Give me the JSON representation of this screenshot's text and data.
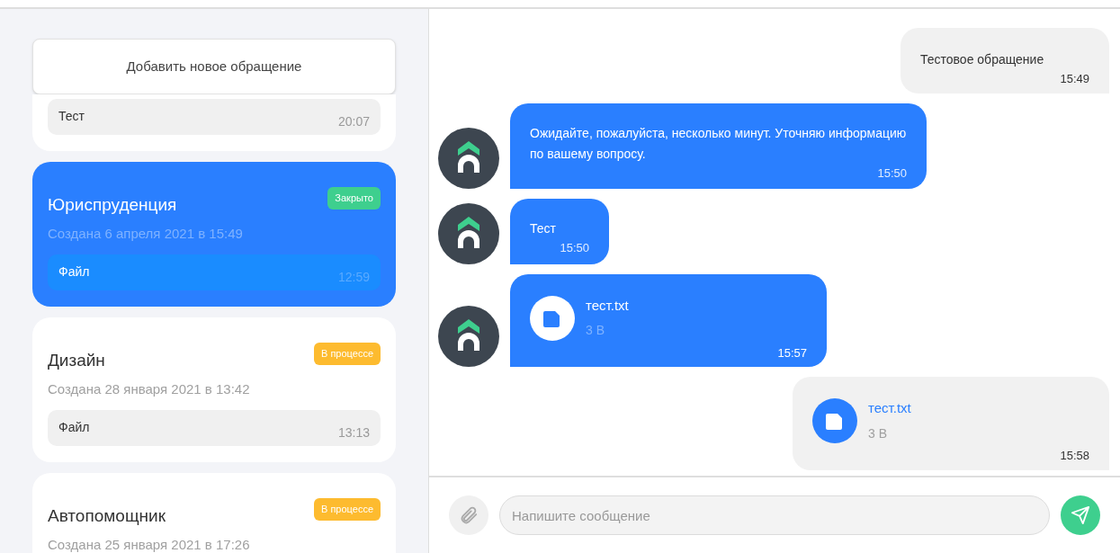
{
  "new_ticket_button": "Добавить новое обращение",
  "tickets": [
    {
      "selected": false,
      "preview": {
        "text": "Тест",
        "time": "20:07"
      }
    },
    {
      "title": "Юриспруденция",
      "created": "Создана 6 апреля 2021 в 15:49",
      "status": {
        "label": "Закрыто",
        "color": "#3ecf8e"
      },
      "selected": true,
      "preview": {
        "text": "Файл",
        "time": "12:59"
      }
    },
    {
      "title": "Дизайн",
      "created": "Создана 28 января 2021 в 13:42",
      "status": {
        "label": "В процессе",
        "color": "#fdbb2f"
      },
      "selected": false,
      "preview": {
        "text": "Файл",
        "time": "13:13"
      }
    },
    {
      "title": "Автопомощник",
      "created": "Создана 25 января 2021 в 17:26",
      "status": {
        "label": "В процессе",
        "color": "#fdbb2f"
      },
      "selected": false
    }
  ],
  "messages": [
    {
      "outgoing": true,
      "kind": "text",
      "text": "Тестовое обращение",
      "time": "15:49"
    },
    {
      "outgoing": false,
      "kind": "text",
      "text": "Ожидайте, пожалуйста, несколько минут. Уточняю информацию по вашему вопросу.",
      "time": "15:50"
    },
    {
      "outgoing": false,
      "kind": "text",
      "text": "Тест",
      "time": "15:50"
    },
    {
      "outgoing": false,
      "kind": "file",
      "file_name": "тест.txt",
      "file_size": "3 B",
      "time": "15:57"
    },
    {
      "outgoing": true,
      "kind": "file",
      "file_name": "тест.txt",
      "file_size": "3 B",
      "time": "15:58"
    }
  ],
  "composer": {
    "placeholder": "Напишите сообщение"
  }
}
